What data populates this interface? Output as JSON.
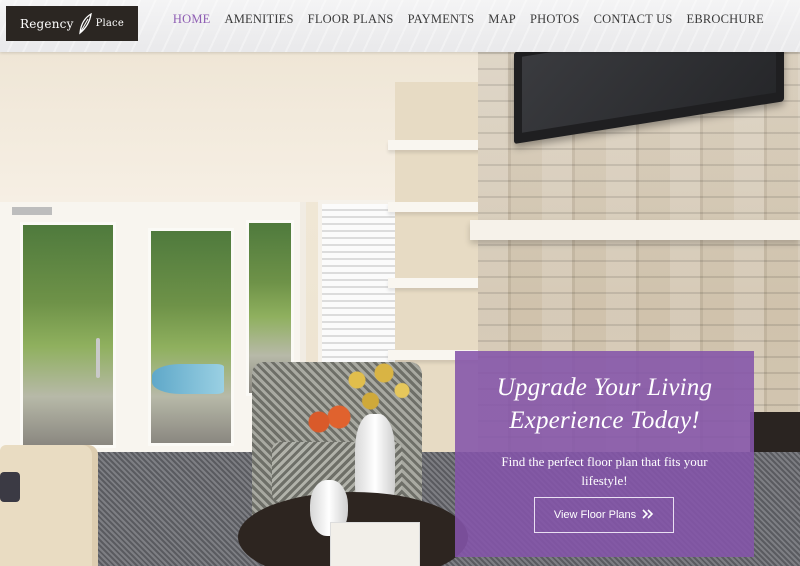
{
  "brand": {
    "logo_text_left": "Regency",
    "logo_text_right": "Place"
  },
  "nav": {
    "items": [
      "HOME",
      "AMENITIES",
      "FLOOR PLANS",
      "PAYMENTS",
      "MAP",
      "PHOTOS",
      "CONTACT US",
      "EBROCHURE"
    ],
    "active": "HOME"
  },
  "hero": {
    "headline_line1": "Upgrade Your Living",
    "headline_line2": "Experience Today!",
    "subtext": "Find the perfect floor plan that fits your lifestyle!",
    "cta_label": "View Floor Plans",
    "cta_icon": "double-chevron-right-icon"
  },
  "colors": {
    "accent": "#8e5db3",
    "overlay": "#8454aa",
    "logo_bg": "#2b2622"
  }
}
